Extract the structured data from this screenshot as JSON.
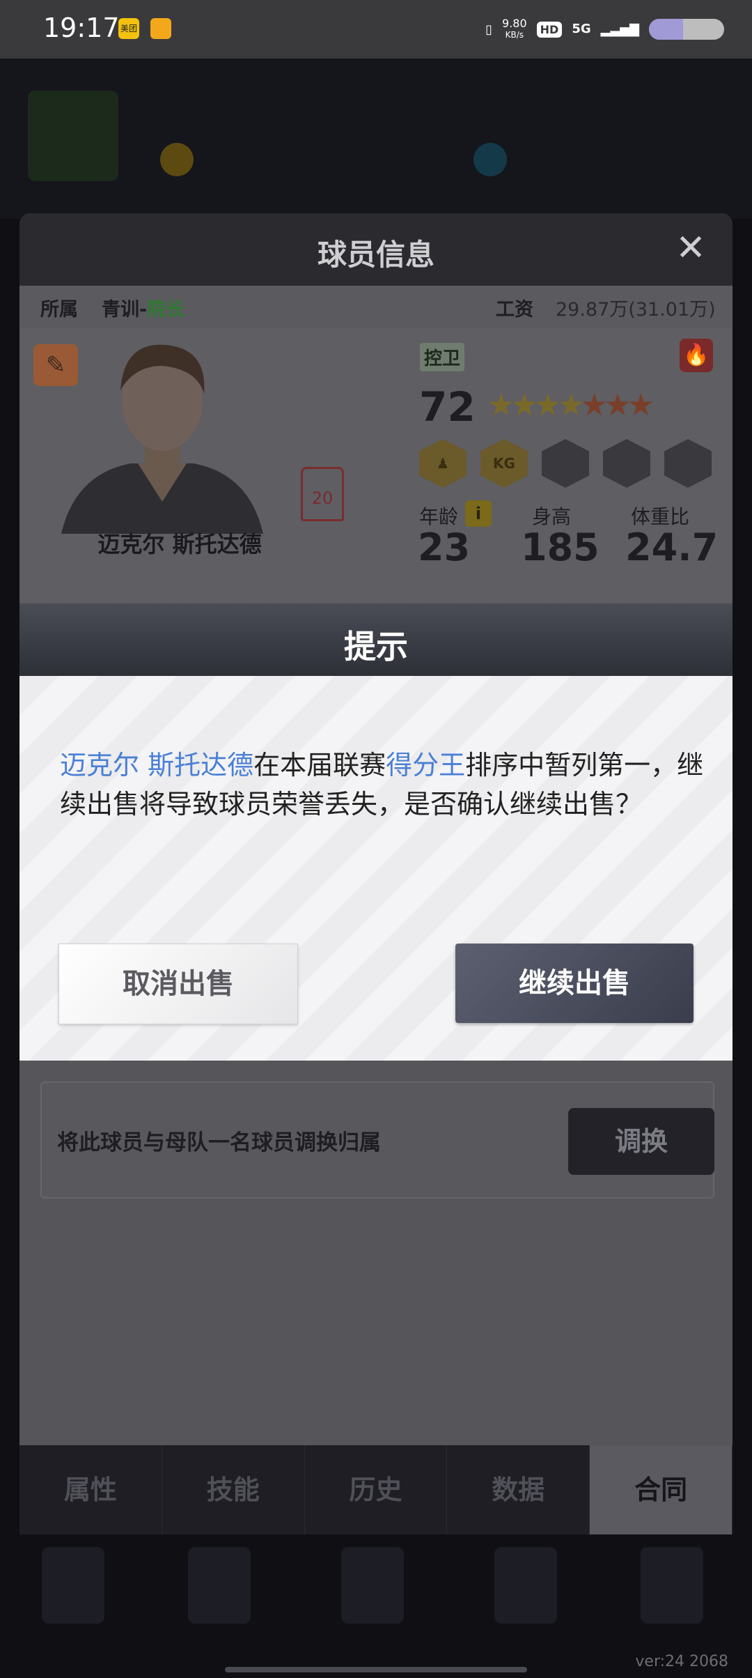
{
  "status_bar": {
    "time": "19:17",
    "app1_label": "美团",
    "speed_value": "9.80",
    "speed_unit": "KB/s",
    "hd": "HD",
    "network": "5G",
    "battery_level": 0.45
  },
  "panel": {
    "title": "球员信息",
    "close_label": "✕",
    "belong_label": "所属",
    "belong_value": "青训-",
    "belong_role": "院长",
    "wage_label": "工资",
    "wage_value": "29.87万(31.01万)",
    "player_name": "迈克尔 斯托达德",
    "jersey_number": "20",
    "position": "控卫",
    "rating": "72",
    "stars_gold": "★★★★",
    "stars_red": "★★★",
    "badge_kg": "KG",
    "age_label": "年龄",
    "age_value": "23",
    "info_icon": "i",
    "height_label": "身高",
    "height_value": "185",
    "bmi_label": "体重比",
    "bmi_value": "24.7"
  },
  "swap": {
    "text": "将此球员与母队一名球员调换归属",
    "button": "调换"
  },
  "tabs": [
    "属性",
    "技能",
    "历史",
    "数据",
    "合同"
  ],
  "dialog": {
    "title": "提示",
    "msg_name": "迈克尔 斯托达德",
    "msg_part1": "在本届联赛",
    "msg_award": "得分王",
    "msg_part2": "排序中暂列第一，继续出售将导致球员荣誉丢失，是否确认继续出售？",
    "cancel_label": "取消出售",
    "continue_label": "继续出售"
  },
  "footer": {
    "version": "ver:24   2068"
  },
  "colors": {
    "highlight": "#4a7fd6",
    "dialog_header": "#2e3038",
    "continue_button": "#3a3d4c"
  }
}
